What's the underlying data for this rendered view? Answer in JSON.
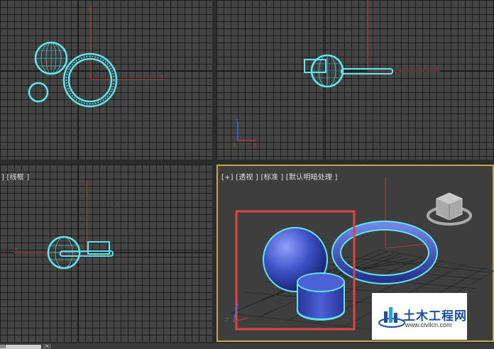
{
  "viewports": {
    "bottom_left_label": "] [线框 ]",
    "perspective_label": "[+] [透视 ] [标准 ] [默认明暗处理 ]"
  },
  "axes": {
    "x": "x",
    "y": "y",
    "z": "z"
  },
  "status": {
    "value": "00",
    "button": ">"
  },
  "watermark": {
    "name": "土木工程网",
    "url": "www.civilcn.com"
  },
  "colors": {
    "selection_outline": "#5fe7f0",
    "object_blue": "#3e55c9",
    "grid_axis": "#b33a3a",
    "active_border": "#c8a64a",
    "select_box": "#e04545"
  }
}
